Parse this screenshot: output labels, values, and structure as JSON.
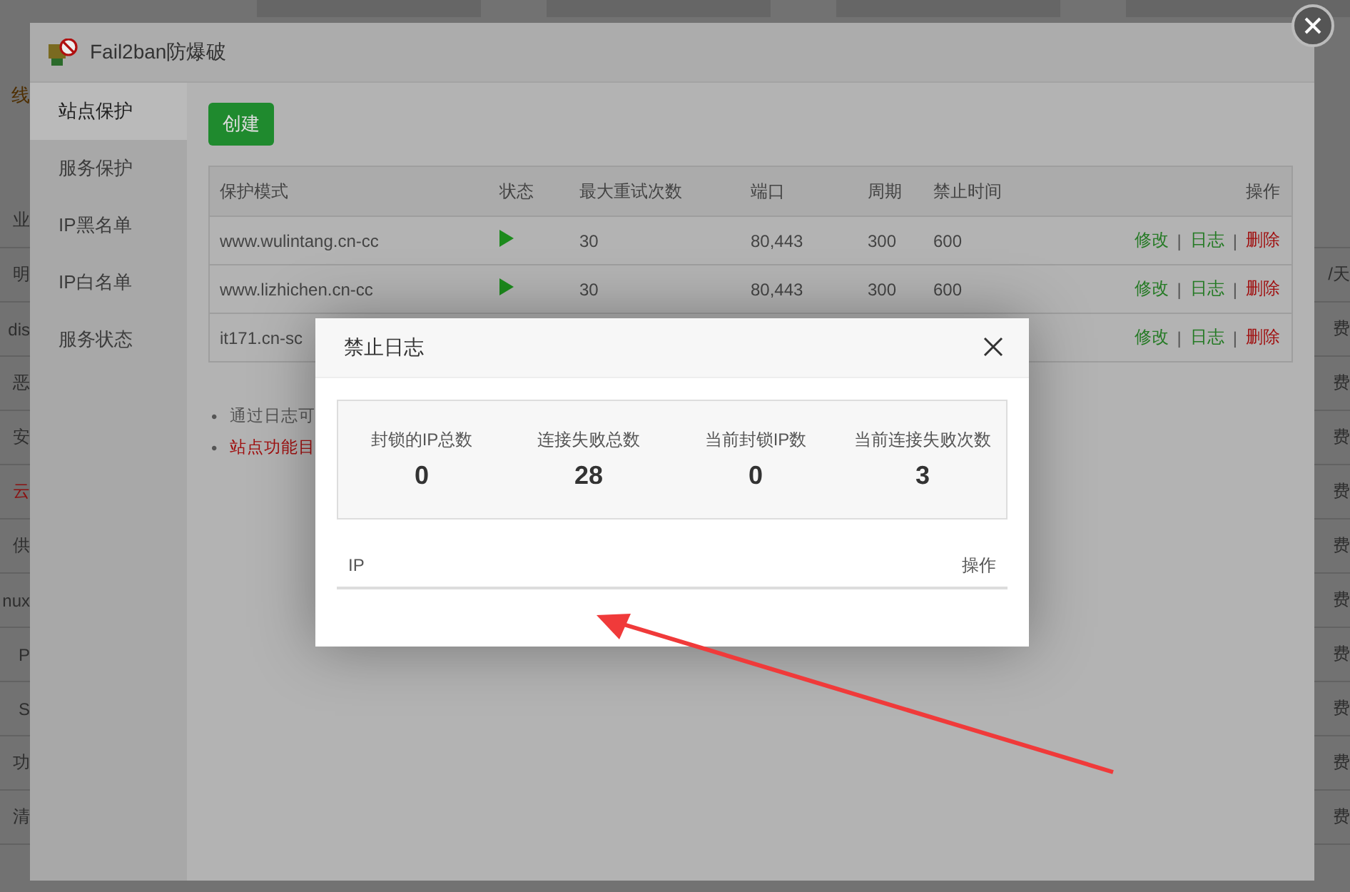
{
  "background_page": {
    "heading": "线",
    "rows": [
      {
        "left": "业",
        "kind": "plain"
      },
      {
        "left": "明",
        "right": "/天",
        "kind": "plain"
      },
      {
        "left": "dis",
        "right": "费",
        "kind": "plain"
      },
      {
        "left": "恶",
        "right": "费",
        "kind": "plain"
      },
      {
        "left": "安",
        "right": "费",
        "kind": "plain"
      },
      {
        "left": "云",
        "right": "费",
        "kind": "alert"
      },
      {
        "left": "供",
        "right": "费",
        "kind": "plain"
      },
      {
        "left": "nux",
        "right": "费",
        "kind": "plain"
      },
      {
        "left": "P",
        "right": "费",
        "kind": "plain"
      },
      {
        "left": "S",
        "right": "费",
        "kind": "plain"
      },
      {
        "left": "功",
        "right": "费",
        "kind": "plain"
      },
      {
        "left": "清",
        "right": "费",
        "kind": "plain"
      }
    ]
  },
  "panel": {
    "title": "Fail2ban防爆破",
    "sidebar": [
      {
        "label": "站点保护",
        "selected": true
      },
      {
        "label": "服务保护",
        "selected": false
      },
      {
        "label": "IP黑名单",
        "selected": false
      },
      {
        "label": "IP白名单",
        "selected": false
      },
      {
        "label": "服务状态",
        "selected": false
      }
    ],
    "create_button": "创建",
    "table": {
      "columns": [
        "保护模式",
        "状态",
        "最大重试次数",
        "端口",
        "周期",
        "禁止时间",
        "操作"
      ],
      "rows": [
        {
          "mode": "www.wulintang.cn-cc",
          "running": true,
          "retries": "30",
          "port": "80,443",
          "period": "300",
          "ban_time": "600",
          "actions": [
            {
              "label": "修改",
              "kind": "normal"
            },
            {
              "separator": "|",
              "label": "日志",
              "kind": "normal"
            },
            {
              "separator": "|",
              "label": "删除",
              "kind": "danger"
            }
          ]
        },
        {
          "mode": "www.lizhichen.cn-cc",
          "running": true,
          "retries": "30",
          "port": "80,443",
          "period": "300",
          "ban_time": "600",
          "actions": [
            {
              "label": "修改",
              "kind": "normal"
            },
            {
              "separator": "|",
              "label": "日志",
              "kind": "normal"
            },
            {
              "separator": "|",
              "label": "删除",
              "kind": "danger"
            }
          ]
        },
        {
          "mode": "it171.cn-sc",
          "actions": [
            {
              "label": "修改",
              "kind": "normal"
            },
            {
              "separator": "|",
              "label": "日志",
              "kind": "normal"
            },
            {
              "separator": "|",
              "label": "删除",
              "kind": "danger"
            }
          ]
        }
      ]
    },
    "notes": [
      {
        "bullet": "•",
        "text": "通过日志可",
        "kind": "normal"
      },
      {
        "bullet": "•",
        "text": "站点功能目",
        "kind": "warning"
      }
    ]
  },
  "dialog": {
    "title": "禁止日志",
    "stats": [
      {
        "label": "封锁的IP总数",
        "value": "0"
      },
      {
        "label": "连接失败总数",
        "value": "28"
      },
      {
        "label": "当前封锁IP数",
        "value": "0"
      },
      {
        "label": "当前连接失败次数",
        "value": "3"
      }
    ],
    "columns": [
      "IP",
      "操作"
    ]
  }
}
